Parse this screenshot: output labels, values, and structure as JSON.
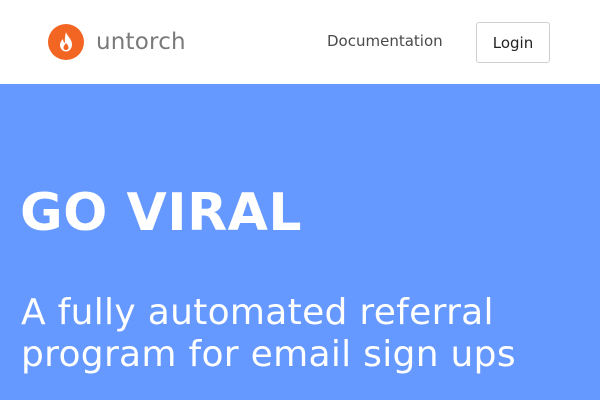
{
  "brand": {
    "name": "untorch",
    "logo_icon": "flame-icon",
    "logo_color": "#f26522"
  },
  "nav": {
    "documentation_label": "Documentation",
    "login_label": "Login"
  },
  "hero": {
    "title": "GO VIRAL",
    "subtitle": "A fully automated referral program for email sign ups",
    "background_color": "#6699ff"
  }
}
